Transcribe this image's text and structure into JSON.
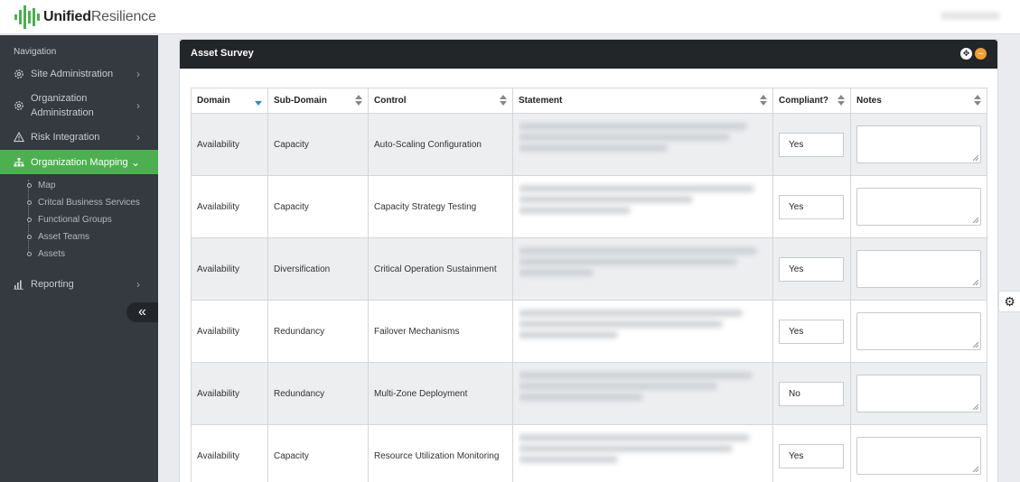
{
  "brand": {
    "name_bold": "Unified",
    "name_light": "Resilience",
    "accent": "#4caf50"
  },
  "sidebar": {
    "heading": "Navigation",
    "items": [
      {
        "label": "Site Administration",
        "icon": "gear-icon"
      },
      {
        "label": "Organization Administration",
        "icon": "cog-icon"
      },
      {
        "label": "Risk Integration",
        "icon": "warning-icon"
      },
      {
        "label": "Organization Mapping",
        "icon": "sitemap-icon",
        "active": true
      },
      {
        "label": "Reporting",
        "icon": "bar-chart-icon"
      }
    ],
    "sub_items": [
      "Map",
      "Critcal Business Services",
      "Functional Groups",
      "Asset Teams",
      "Assets"
    ],
    "collapse_glyph": "«"
  },
  "card": {
    "title": "Asset Survey"
  },
  "table": {
    "headers": [
      "Domain",
      "Sub-Domain",
      "Control",
      "Statement",
      "Compliant?",
      "Notes"
    ],
    "rows": [
      {
        "domain": "Availability",
        "subdomain": "Capacity",
        "control": "Auto-Scaling Configuration",
        "compliant": "Yes",
        "notes": ""
      },
      {
        "domain": "Availability",
        "subdomain": "Capacity",
        "control": "Capacity Strategy Testing",
        "compliant": "Yes",
        "notes": ""
      },
      {
        "domain": "Availability",
        "subdomain": "Diversification",
        "control": "Critical Operation Sustainment",
        "compliant": "Yes",
        "notes": ""
      },
      {
        "domain": "Availability",
        "subdomain": "Redundancy",
        "control": "Failover Mechanisms",
        "compliant": "Yes",
        "notes": ""
      },
      {
        "domain": "Availability",
        "subdomain": "Redundancy",
        "control": "Multi-Zone Deployment",
        "compliant": "No",
        "notes": ""
      },
      {
        "domain": "Availability",
        "subdomain": "Capacity",
        "control": "Resource Utilization Monitoring",
        "compliant": "Yes",
        "notes": ""
      }
    ]
  }
}
